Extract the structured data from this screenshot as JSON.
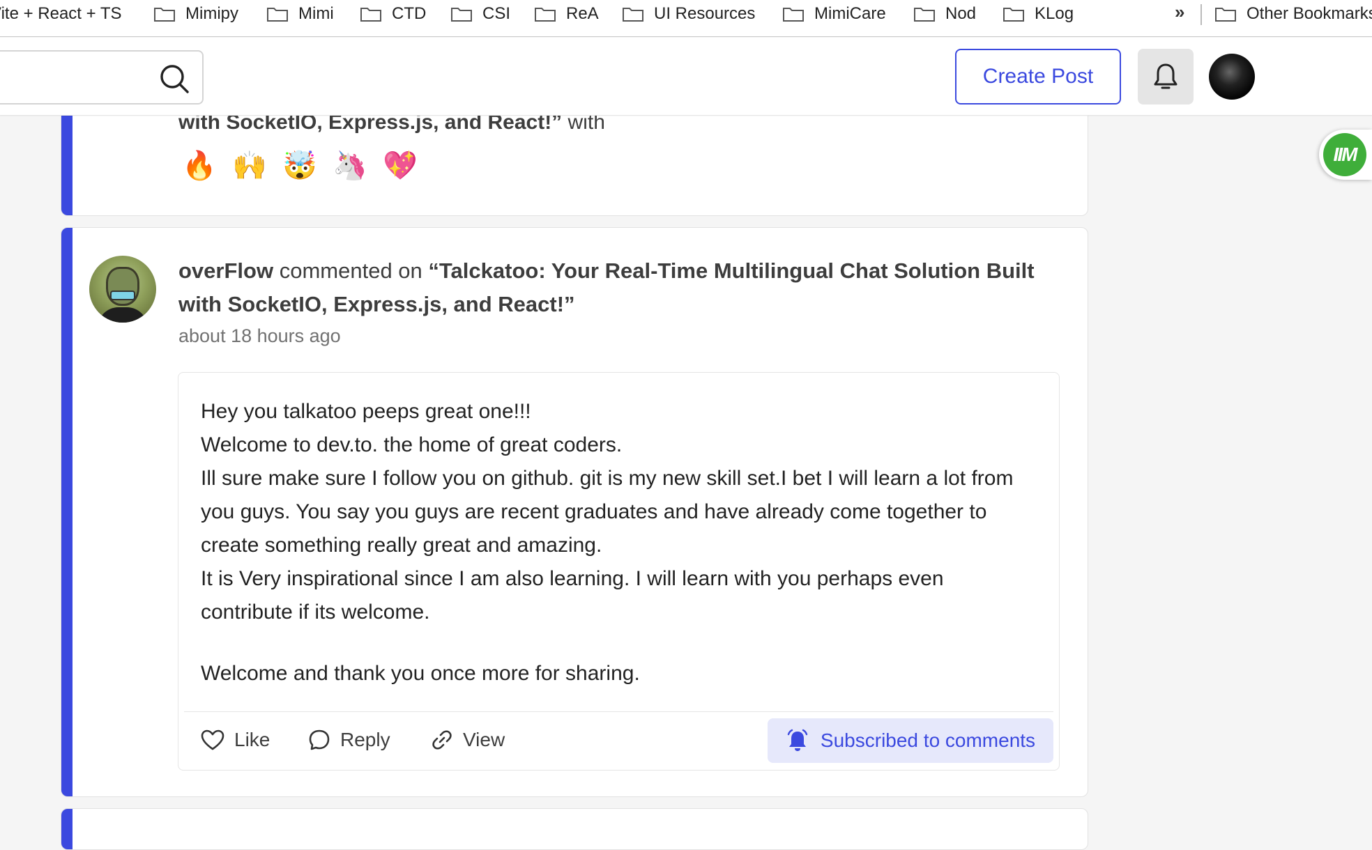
{
  "bookmarks": {
    "items": [
      "Vite + React + TS",
      "Mimipy",
      "Mimi",
      "CTD",
      "CSI",
      "ReA",
      "UI Resources",
      "MimiCare",
      "Nod",
      "KLog"
    ],
    "more": "»",
    "other": "Other Bookmarks"
  },
  "header": {
    "create_post": "Create Post"
  },
  "extension": {
    "label": "IIM"
  },
  "card1": {
    "title_tail": "with SocketIO, Express.js, and React!”",
    "suffix": "with",
    "reactions": [
      "🔥",
      "🙌",
      "🤯",
      "🦄",
      "💖"
    ]
  },
  "card2": {
    "user": "overFlow",
    "action": "commented on",
    "post_title": "“Talckatoo: Your Real-Time Multilingual Chat Solution Built with SocketIO, Express.js, and React!”",
    "timestamp": "about 18 hours ago",
    "comment": {
      "line1": "Hey you talkatoo peeps great one!!!",
      "line2": "Welcome to dev.to. the home of great coders.",
      "line3": "Ill sure make sure I follow you on github. git is my new skill set.I bet I will learn a lot from you guys. You say you guys are recent graduates and have already come together to create something really great and amazing.",
      "line4": "It is Very inspirational since I am also learning. I will learn with you perhaps even contribute if its welcome.",
      "line5": "Welcome and thank you once more for sharing."
    },
    "actions": {
      "like": "Like",
      "reply": "Reply",
      "view": "View",
      "subscribed": "Subscribed to comments"
    }
  },
  "colors": {
    "accent": "#3b49df",
    "subscribed_bg": "#e6e8fb",
    "extension_green": "#3fae3a"
  },
  "icons": [
    "folder-icon",
    "search-icon",
    "bell-icon",
    "heart-icon",
    "comment-icon",
    "link-icon",
    "bell-ring-icon"
  ]
}
